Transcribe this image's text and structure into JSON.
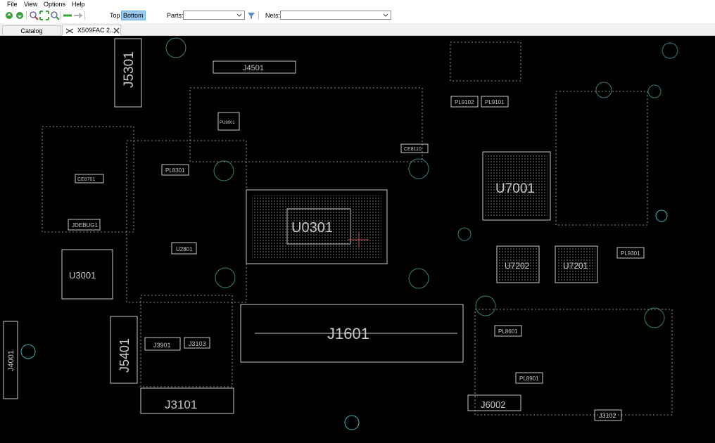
{
  "menu": [
    "File",
    "View",
    "Options",
    "Help"
  ],
  "toolbar": {
    "icons": [
      "open-icon",
      "reload-icon",
      "zoom-in-icon",
      "zoom-fit-icon",
      "zoom-out-icon",
      "back-arrow-icon",
      "forward-arrow-icon"
    ],
    "layer_top": "Top",
    "layer_bottom": "Bottom",
    "parts_label": "Parts:",
    "parts_value": "",
    "nets_label": "Nets:",
    "nets_value": "",
    "accent": "#99c9ef"
  },
  "tabs": {
    "catalog": "Catalog",
    "board": "X509FAC 2..."
  },
  "board": {
    "background": "#000000",
    "silkscreen_color": "#c8c8c8",
    "pad_color": "#46b4b4",
    "refdes": {
      "u0301": "U0301",
      "u7001": "U7001",
      "u7202": "U7202",
      "u7201": "U7201",
      "u3001": "U3001",
      "j1601": "J1601",
      "j5301": "J5301",
      "j5401": "J5401",
      "j4001": "J4001",
      "j3101": "J3101",
      "j4501": "J4501",
      "j6002": "J6002",
      "j3901": "J3901",
      "j3103": "J3103",
      "j3102": "J3102",
      "u2801": "U2801",
      "jdebug1": "JDEBUG1",
      "pl9102": "PL9102",
      "pl9101": "PL9101",
      "pl8301": "PL8301",
      "pl9301": "PL9301",
      "pl8601": "PL8601",
      "pl8901": "PL8901",
      "ce8110": "CE8110",
      "pu8001": "PU8001",
      "ce8701": "CE8701"
    }
  }
}
